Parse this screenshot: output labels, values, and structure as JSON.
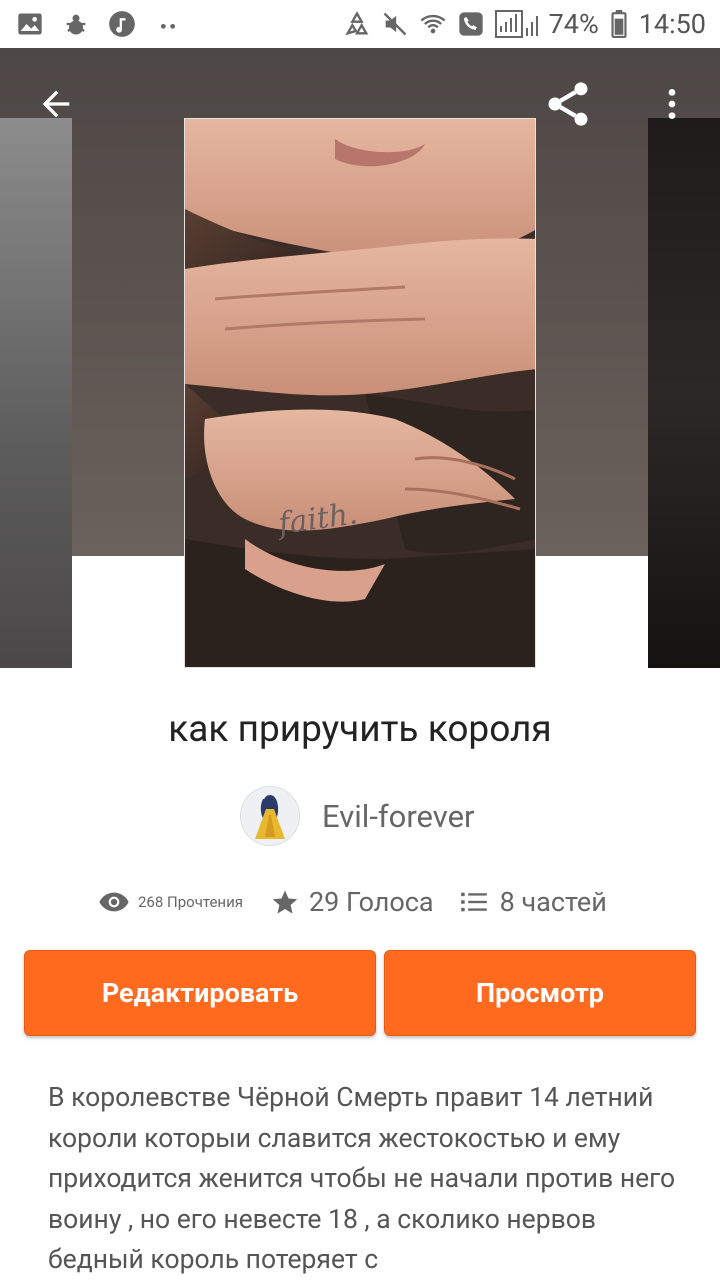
{
  "status_bar": {
    "battery": "74%",
    "time": "14:50",
    "left_icons": [
      "image-icon",
      "bug-icon",
      "music-icon",
      "dots-icon"
    ],
    "right_icons": [
      "recycle-icon",
      "mute-icon",
      "wifi-call-icon",
      "phone-icon",
      "signal-icon",
      "battery-icon"
    ]
  },
  "header": {
    "back_icon": "arrow-left-icon",
    "share_icon": "share-icon",
    "menu_icon": "more-vert-icon"
  },
  "story": {
    "title": "как приручить короля",
    "author": "Evil-forever",
    "stats": {
      "reads": "268 Прочтения",
      "votes": "29 Голоса",
      "parts": "8 частей"
    },
    "description": "В королевстве Чёрной Смерть правит 14 летний короли которыи славится жестокостью и ему приходится женится чтобы не начали против него воину , но его невесте 18 , а сколико нервов бедный король потеряет с"
  },
  "actions": {
    "edit_label": "Редактировать",
    "view_label": "Просмотр"
  },
  "colors": {
    "accent": "#ff6a1f",
    "text_primary": "#222222",
    "text_secondary": "#666666"
  }
}
